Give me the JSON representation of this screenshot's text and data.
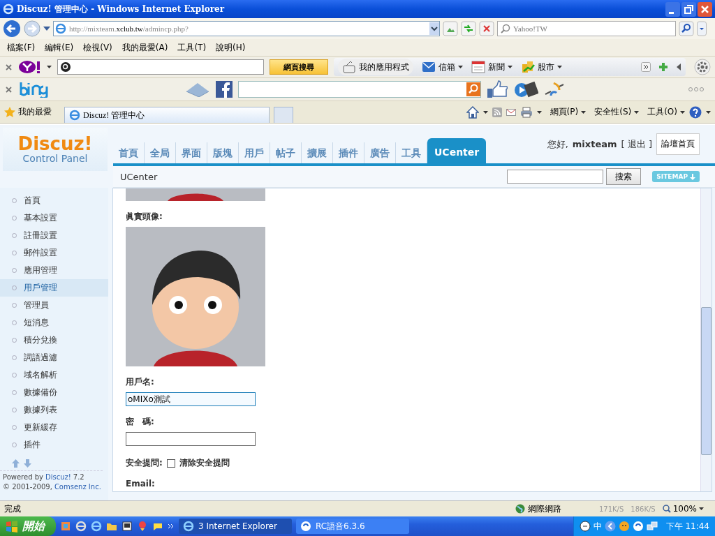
{
  "window": {
    "title": "Discuz! 管理中心 - Windows Internet Explorer"
  },
  "address_bar": {
    "url_prefix": "http://mixteam.",
    "url_host": "xclub.tw",
    "url_path": "/admincp.php?",
    "search_placeholder": "Yahoo!TW"
  },
  "menu_bar": {
    "items": [
      "檔案(F)",
      "編輯(E)",
      "檢視(V)",
      "我的最愛(A)",
      "工具(T)",
      "說明(H)"
    ]
  },
  "yahoo_toolbar": {
    "search_button": "網頁搜尋",
    "items": [
      {
        "label": "我的應用程式",
        "kind": "plain"
      },
      {
        "label": "信箱",
        "kind": "menu"
      },
      {
        "label": "新聞",
        "kind": "menu"
      },
      {
        "label": "股市",
        "kind": "menu"
      }
    ]
  },
  "favorites_bar": {
    "favorites": "我的最愛",
    "tab_title": "Discuz! 管理中心",
    "commands": [
      "網頁(P)",
      "安全性(S)",
      "工具(O)"
    ]
  },
  "page": {
    "logo": {
      "title": "Discuz!",
      "subtitle": "Control Panel"
    },
    "nav_tabs": [
      {
        "label": "首頁",
        "selected": false
      },
      {
        "label": "全局",
        "selected": false
      },
      {
        "label": "界面",
        "selected": false
      },
      {
        "label": "版塊",
        "selected": false
      },
      {
        "label": "用戶",
        "selected": false
      },
      {
        "label": "帖子",
        "selected": false
      },
      {
        "label": "擴展",
        "selected": false
      },
      {
        "label": "插件",
        "selected": false
      },
      {
        "label": "廣告",
        "selected": false
      },
      {
        "label": "工具",
        "selected": false
      },
      {
        "label": "UCenter",
        "selected": true
      }
    ],
    "greeting": "您好,",
    "username": "mixteam",
    "logout": "[ 退出 ]",
    "home_button": "論壇首頁",
    "breadcrumb": "UCenter",
    "search_button": "搜索",
    "sitemap": "SITEMAP",
    "sidebar": {
      "items": [
        {
          "label": "首頁",
          "selected": false
        },
        {
          "label": "基本設置",
          "selected": false
        },
        {
          "label": "註冊設置",
          "selected": false
        },
        {
          "label": "郵件設置",
          "selected": false
        },
        {
          "label": "應用管理",
          "selected": false
        },
        {
          "label": "用戶管理",
          "selected": true
        },
        {
          "label": "管理員",
          "selected": false
        },
        {
          "label": "短消息",
          "selected": false
        },
        {
          "label": "積分兌換",
          "selected": false
        },
        {
          "label": "詞語過濾",
          "selected": false
        },
        {
          "label": "域名解析",
          "selected": false
        },
        {
          "label": "數據備份",
          "selected": false
        },
        {
          "label": "數據列表",
          "selected": false
        },
        {
          "label": "更新緩存",
          "selected": false
        },
        {
          "label": "插件",
          "selected": false
        }
      ],
      "powered_prefix": "Powered by",
      "powered_link": "Discuz!",
      "version": "7.2",
      "copyright": "© 2001-2009,",
      "company": "Comsenz Inc."
    },
    "form": {
      "avatar_label": "眞實頭像:",
      "fields": [
        {
          "label": "用戶名:",
          "value": "oMIXo測試",
          "focused": true
        },
        {
          "label": "密　碼:",
          "focused": false
        }
      ],
      "security_label": "安全提問:",
      "clear_security": {
        "label": "清除安全提問",
        "checked": false
      },
      "email_label": "Email:"
    }
  },
  "status_bar": {
    "text": "完成",
    "zone": "網際網路",
    "net_down": "171K/S",
    "net_up": "186K/S",
    "zoom": "100%"
  },
  "taskbar": {
    "start": "開始",
    "tasks": [
      {
        "label": "3 Internet Explorer",
        "selected": true
      },
      {
        "label": "RC語音6.3.6",
        "selected": false
      }
    ],
    "ime": "中",
    "clock": "下午 11:44"
  }
}
